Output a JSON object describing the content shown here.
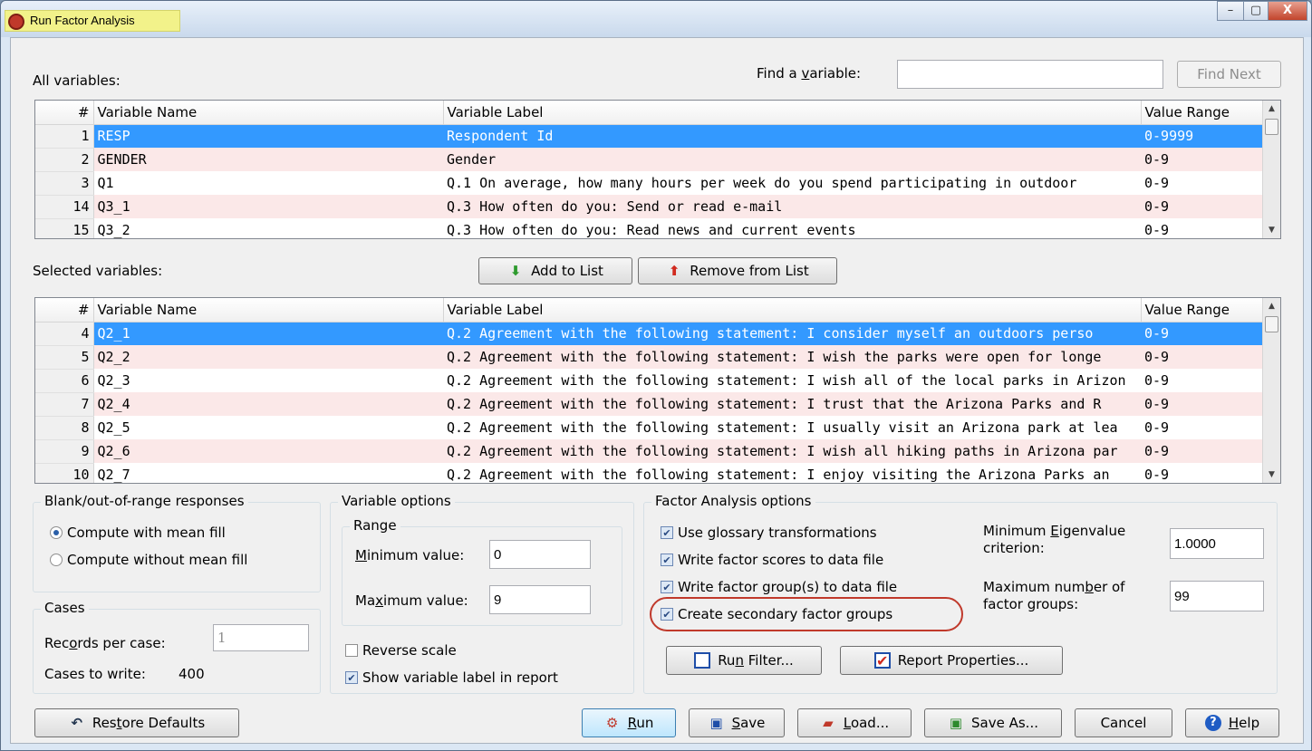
{
  "window": {
    "title": "Run Factor Analysis",
    "controls": [
      "–",
      "▢",
      "X"
    ]
  },
  "search": {
    "all_variables_label": "All variables:",
    "find_label": "Find a variable:",
    "find_value": "",
    "find_next": "Find Next"
  },
  "all_grid": {
    "headers": [
      "#",
      "Variable Name",
      "Variable Label",
      "Value Range"
    ],
    "rows": [
      {
        "n": "1",
        "name": "RESP",
        "label": "Respondent Id",
        "range": "0-9999",
        "style": "sel"
      },
      {
        "n": "2",
        "name": "GENDER",
        "label": "Gender",
        "range": "0-9",
        "style": "alt"
      },
      {
        "n": "3",
        "name": "Q1",
        "label": "Q.1 On average, how many hours per week do you spend participating in outdoor",
        "range": "0-9",
        "style": ""
      },
      {
        "n": "14",
        "name": "Q3_1",
        "label": "Q.3 How often do you: Send or read e-mail",
        "range": "0-9",
        "style": "alt"
      },
      {
        "n": "15",
        "name": "Q3_2",
        "label": "Q.3 How often do you: Read news and current events",
        "range": "0-9",
        "style": ""
      }
    ]
  },
  "selected_label": "Selected variables:",
  "add_button": "Add to List",
  "remove_button": "Remove from List",
  "sel_grid": {
    "headers": [
      "#",
      "Variable Name",
      "Variable Label",
      "Value Range"
    ],
    "rows": [
      {
        "n": "4",
        "name": "Q2_1",
        "label": "Q.2 Agreement with the following statement: I consider myself an outdoors perso",
        "range": "0-9",
        "style": "sel"
      },
      {
        "n": "5",
        "name": "Q2_2",
        "label": "Q.2 Agreement with the following statement: I wish the parks were open for longe",
        "range": "0-9",
        "style": "alt"
      },
      {
        "n": "6",
        "name": "Q2_3",
        "label": "Q.2 Agreement with the following statement: I wish all of the local parks in Arizon",
        "range": "0-9",
        "style": ""
      },
      {
        "n": "7",
        "name": "Q2_4",
        "label": "Q.2 Agreement with the following statement: I trust that the Arizona Parks and R",
        "range": "0-9",
        "style": "alt"
      },
      {
        "n": "8",
        "name": "Q2_5",
        "label": "Q.2 Agreement with the following statement: I usually visit an Arizona park at lea",
        "range": "0-9",
        "style": ""
      },
      {
        "n": "9",
        "name": "Q2_6",
        "label": "Q.2 Agreement with the following statement: I wish all hiking paths in Arizona par",
        "range": "0-9",
        "style": "alt"
      },
      {
        "n": "10",
        "name": "Q2_7",
        "label": "Q.2 Agreement with the following statement: I enjoy visiting the Arizona Parks an",
        "range": "0-9",
        "style": ""
      }
    ]
  },
  "blank": {
    "title": "Blank/out-of-range responses",
    "opt1": "Compute with mean fill",
    "opt2": "Compute without mean fill",
    "selected": "opt1"
  },
  "cases": {
    "title": "Cases",
    "records_label_pre": "Rec",
    "records_label_ul": "o",
    "records_label_post": "rds per case:",
    "records_value": "1",
    "write_label": "Cases to write:",
    "write_value": "400"
  },
  "varopts": {
    "title": "Variable options",
    "range_title": "Range",
    "min_ul": "M",
    "min_rest": "inimum value:",
    "min_value": "0",
    "max_pre": "Ma",
    "max_ul": "x",
    "max_rest": "imum value:",
    "max_value": "9",
    "reverse": "Reverse scale",
    "reverse_checked": false,
    "show_label": "Show variable label in report",
    "show_label_checked": true
  },
  "fa": {
    "title": "Factor Analysis options",
    "opt_glossary": "Use glossary transformations",
    "opt_scores": "Write factor scores to data file",
    "opt_groups": "Write factor group(s) to data file",
    "opt_secondary": "Create secondary factor groups",
    "eigen_pre": "Minimum ",
    "eigen_ul": "E",
    "eigen_rest": "igenvalue",
    "eigen_line2": "criterion:",
    "eigen_value": "1.0000",
    "maxgrp_pre": "Maximum num",
    "maxgrp_ul": "b",
    "maxgrp_rest": "er of",
    "maxgrp_line2": "factor groups:",
    "maxgrp_value": "99",
    "run_filter_pre": "Ru",
    "run_filter_ul": "n",
    "run_filter_rest": " Filter...",
    "report_props": "Report Properties..."
  },
  "footer": {
    "restore_pre": "Res",
    "restore_ul": "t",
    "restore_rest": "ore Defaults",
    "run_ul": "R",
    "run_rest": "un",
    "save_ul": "S",
    "save_rest": "ave",
    "load_ul": "L",
    "load_rest": "oad...",
    "saveas": "Save As...",
    "cancel": "Cancel",
    "help_ul": "H",
    "help_rest": "elp"
  }
}
